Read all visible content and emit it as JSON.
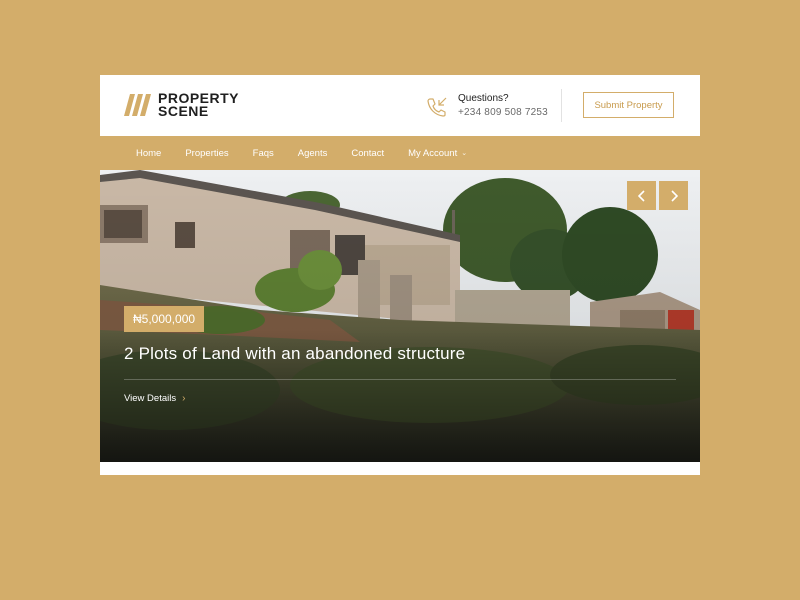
{
  "logo": {
    "line1": "PROPERTY",
    "line2": "SCENE"
  },
  "contact": {
    "label": "Questions?",
    "phone": "+234 809 508 7253"
  },
  "header": {
    "submit_label": "Submit Property"
  },
  "nav": {
    "items": [
      {
        "label": "Home"
      },
      {
        "label": "Properties"
      },
      {
        "label": "Faqs"
      },
      {
        "label": "Agents"
      },
      {
        "label": "Contact"
      },
      {
        "label": "My Account"
      }
    ]
  },
  "hero": {
    "price": "₦5,000,000",
    "title": "2 Plots of Land with an abandoned structure",
    "details_label": "View Details",
    "prev_icon": "chevron-left-icon",
    "next_icon": "chevron-right-icon"
  },
  "colors": {
    "accent": "#d3ad6a",
    "background": "#d3ad6a",
    "text_dark": "#1f1f1f"
  }
}
